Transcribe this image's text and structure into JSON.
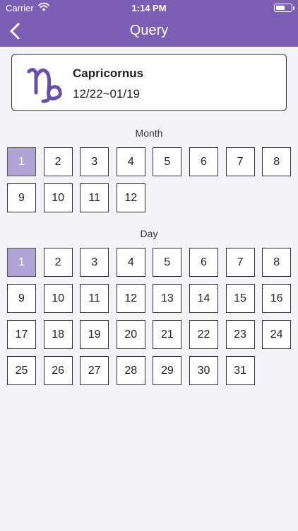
{
  "status_bar": {
    "carrier": "Carrier",
    "time": "1:14 PM"
  },
  "nav": {
    "title": "Query"
  },
  "zodiac": {
    "icon": "capricorn-icon",
    "name": "Capricornus",
    "range": "12/22~01/19"
  },
  "month_section": {
    "label": "Month",
    "selected": "1",
    "items": [
      "1",
      "2",
      "3",
      "4",
      "5",
      "6",
      "7",
      "8",
      "9",
      "10",
      "11",
      "12"
    ]
  },
  "day_section": {
    "label": "Day",
    "selected": "1",
    "items": [
      "1",
      "2",
      "3",
      "4",
      "5",
      "6",
      "7",
      "8",
      "9",
      "10",
      "11",
      "12",
      "13",
      "14",
      "15",
      "16",
      "17",
      "18",
      "19",
      "20",
      "21",
      "22",
      "23",
      "24",
      "25",
      "26",
      "27",
      "28",
      "29",
      "30",
      "31"
    ]
  },
  "colors": {
    "accent": "#7b5fb4",
    "selected_cell": "#b0a3d5",
    "background": "#f4f3f8"
  }
}
